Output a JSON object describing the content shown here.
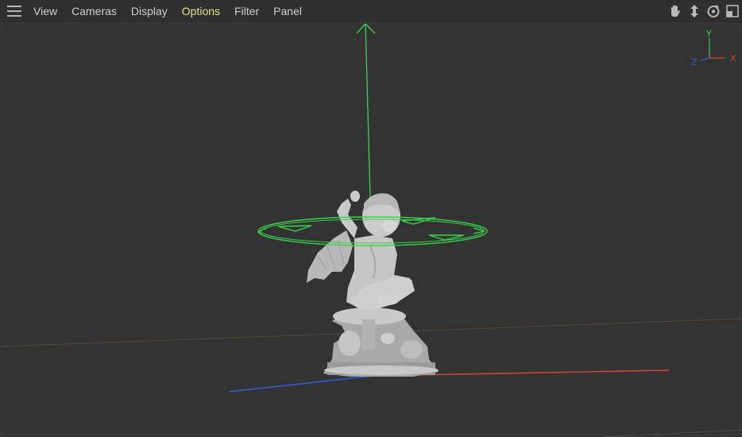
{
  "menubar": {
    "menu_icon": "hamburger-menu-icon",
    "items": [
      {
        "label": "View",
        "active": false
      },
      {
        "label": "Cameras",
        "active": false
      },
      {
        "label": "Display",
        "active": false
      },
      {
        "label": "Options",
        "active": true
      },
      {
        "label": "Filter",
        "active": false
      },
      {
        "label": "Panel",
        "active": false
      }
    ],
    "nav_tools": [
      "pan-hand-icon",
      "dolly-move-icon",
      "orbit-rotate-icon",
      "maximize-panel-icon"
    ]
  },
  "axis_gizmo": {
    "y_label": "Y",
    "x_label": "X",
    "z_label": "Z"
  },
  "colors": {
    "background": "#333333",
    "menubar": "#2f2f2f",
    "menu_text": "#cfcfcf",
    "menu_active": "#e8e08a",
    "axis_x": "#d9443a",
    "axis_y": "#39d24a",
    "axis_z": "#2f5fd0",
    "model": "#bdbdbd"
  },
  "scene": {
    "object": "cupid-statue",
    "manipulator": "rotate-gizmo"
  }
}
